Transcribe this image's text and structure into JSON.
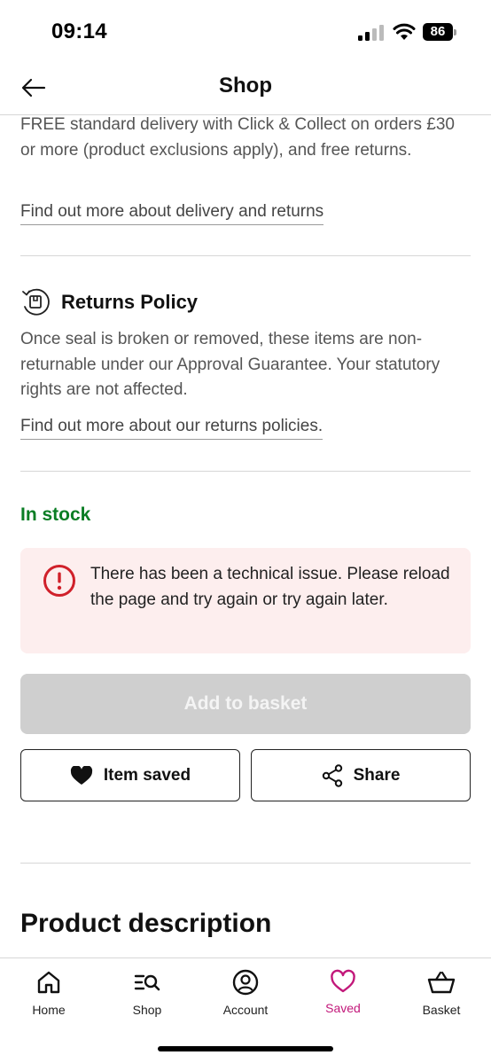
{
  "status_bar": {
    "time": "09:14",
    "battery": "86"
  },
  "header": {
    "title": "Shop"
  },
  "delivery": {
    "text": "FREE standard delivery with Click & Collect on orders £30 or more (product exclusions apply), and free returns.",
    "link": "Find out more about delivery and returns"
  },
  "returns_policy": {
    "title": "Returns Policy",
    "text": "Once seal is broken or removed, these items are non-returnable under our Approval Guarantee. Your statutory rights are not affected.",
    "link": "Find out more about our returns policies."
  },
  "stock_status": "In stock",
  "alert": {
    "message": "There has been a technical issue. Please reload the page and try again or try again later."
  },
  "buttons": {
    "add_to_basket": "Add to basket",
    "item_saved": "Item saved",
    "share": "Share"
  },
  "product_description_title": "Product description",
  "bottom_nav": {
    "items": [
      {
        "label": "Home",
        "icon": "home-icon"
      },
      {
        "label": "Shop",
        "icon": "shop-search-icon"
      },
      {
        "label": "Account",
        "icon": "account-icon"
      },
      {
        "label": "Saved",
        "icon": "heart-icon",
        "active": true
      },
      {
        "label": "Basket",
        "icon": "basket-icon"
      }
    ]
  },
  "colors": {
    "stock_green": "#0a7d24",
    "alert_red": "#d0202a",
    "active_pink": "#c2187a",
    "alert_bg": "#fdeeee"
  }
}
